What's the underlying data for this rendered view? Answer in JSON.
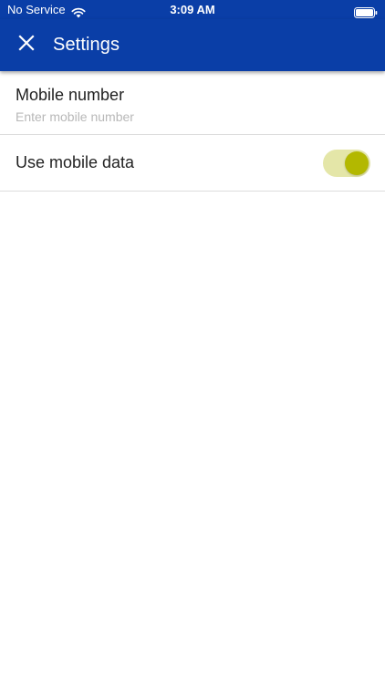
{
  "status_bar": {
    "carrier": "No Service",
    "time": "3:09 AM",
    "icons": [
      "wifi-icon",
      "battery-icon"
    ]
  },
  "app_bar": {
    "title": "Settings",
    "close_icon": "close-icon",
    "background_color": "#0a3ea7"
  },
  "settings": {
    "mobile_number": {
      "label": "Mobile number",
      "value": "",
      "placeholder": "Enter mobile number"
    },
    "mobile_data": {
      "label": "Use mobile data",
      "enabled": true,
      "track_color": "#e4e6a8",
      "thumb_color": "#b3b800"
    }
  }
}
